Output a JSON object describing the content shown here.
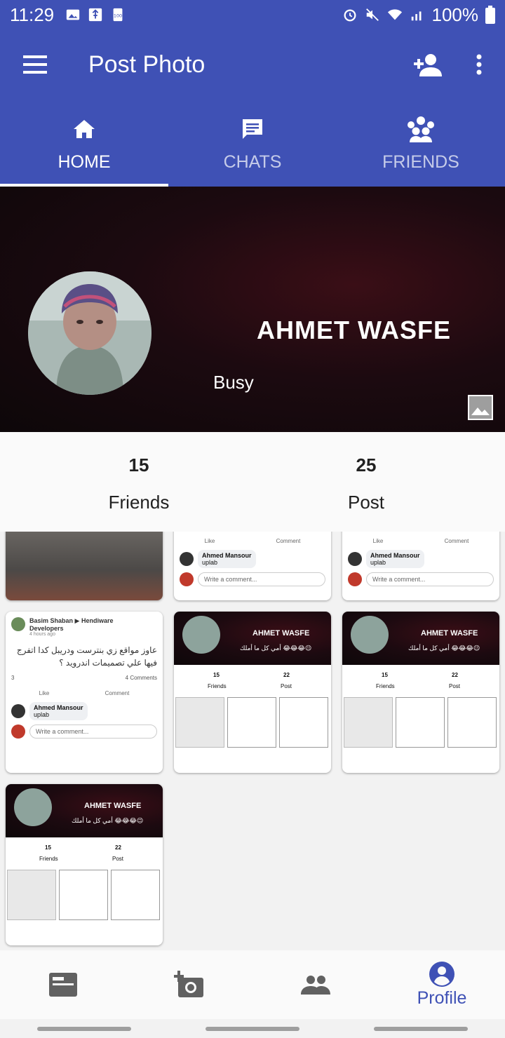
{
  "status_bar": {
    "time": "11:29",
    "battery": "100%"
  },
  "app_bar": {
    "title": "Post Photo"
  },
  "tabs": [
    {
      "label": "HOME",
      "icon": "home-icon"
    },
    {
      "label": "CHATS",
      "icon": "chat-icon"
    },
    {
      "label": "FRIENDS",
      "icon": "friends-icon"
    }
  ],
  "profile": {
    "name": "AHMET WASFE",
    "status": "Busy"
  },
  "stats": {
    "friends_count": "15",
    "friends_label": "Friends",
    "posts_count": "25",
    "posts_label": "Post"
  },
  "thumbs": {
    "post": {
      "author": "Basim Shaban ▶ Hendiware Developers",
      "time": "4 hours ago",
      "text": "عاوز مواقع زي بنترست ودريبل كدا اتفرج فيها علي تصميمات اندرويد ؟",
      "reactions": "3",
      "comments_count": "4 Comments",
      "like": "Like",
      "comment": "Comment",
      "commenter": "Ahmed Mansour",
      "comment_text": "uplab",
      "input_placeholder": "Write a comment..."
    },
    "profile_shot": {
      "name": "AHMET WASFE",
      "status": "أمي كل ما أملك 😂😂😂😉",
      "friends_count": "15",
      "friends_label": "Friends",
      "posts_count": "22",
      "posts_label": "Post"
    }
  },
  "bottom_nav": [
    {
      "icon": "feed-icon",
      "label": ""
    },
    {
      "icon": "add-photo-icon",
      "label": ""
    },
    {
      "icon": "people-icon",
      "label": ""
    },
    {
      "icon": "profile-icon",
      "label": "Profile"
    }
  ],
  "colors": {
    "primary": "#3f51b5",
    "accent_active_tab": "#ffffff",
    "nav_inactive": "#616161"
  }
}
